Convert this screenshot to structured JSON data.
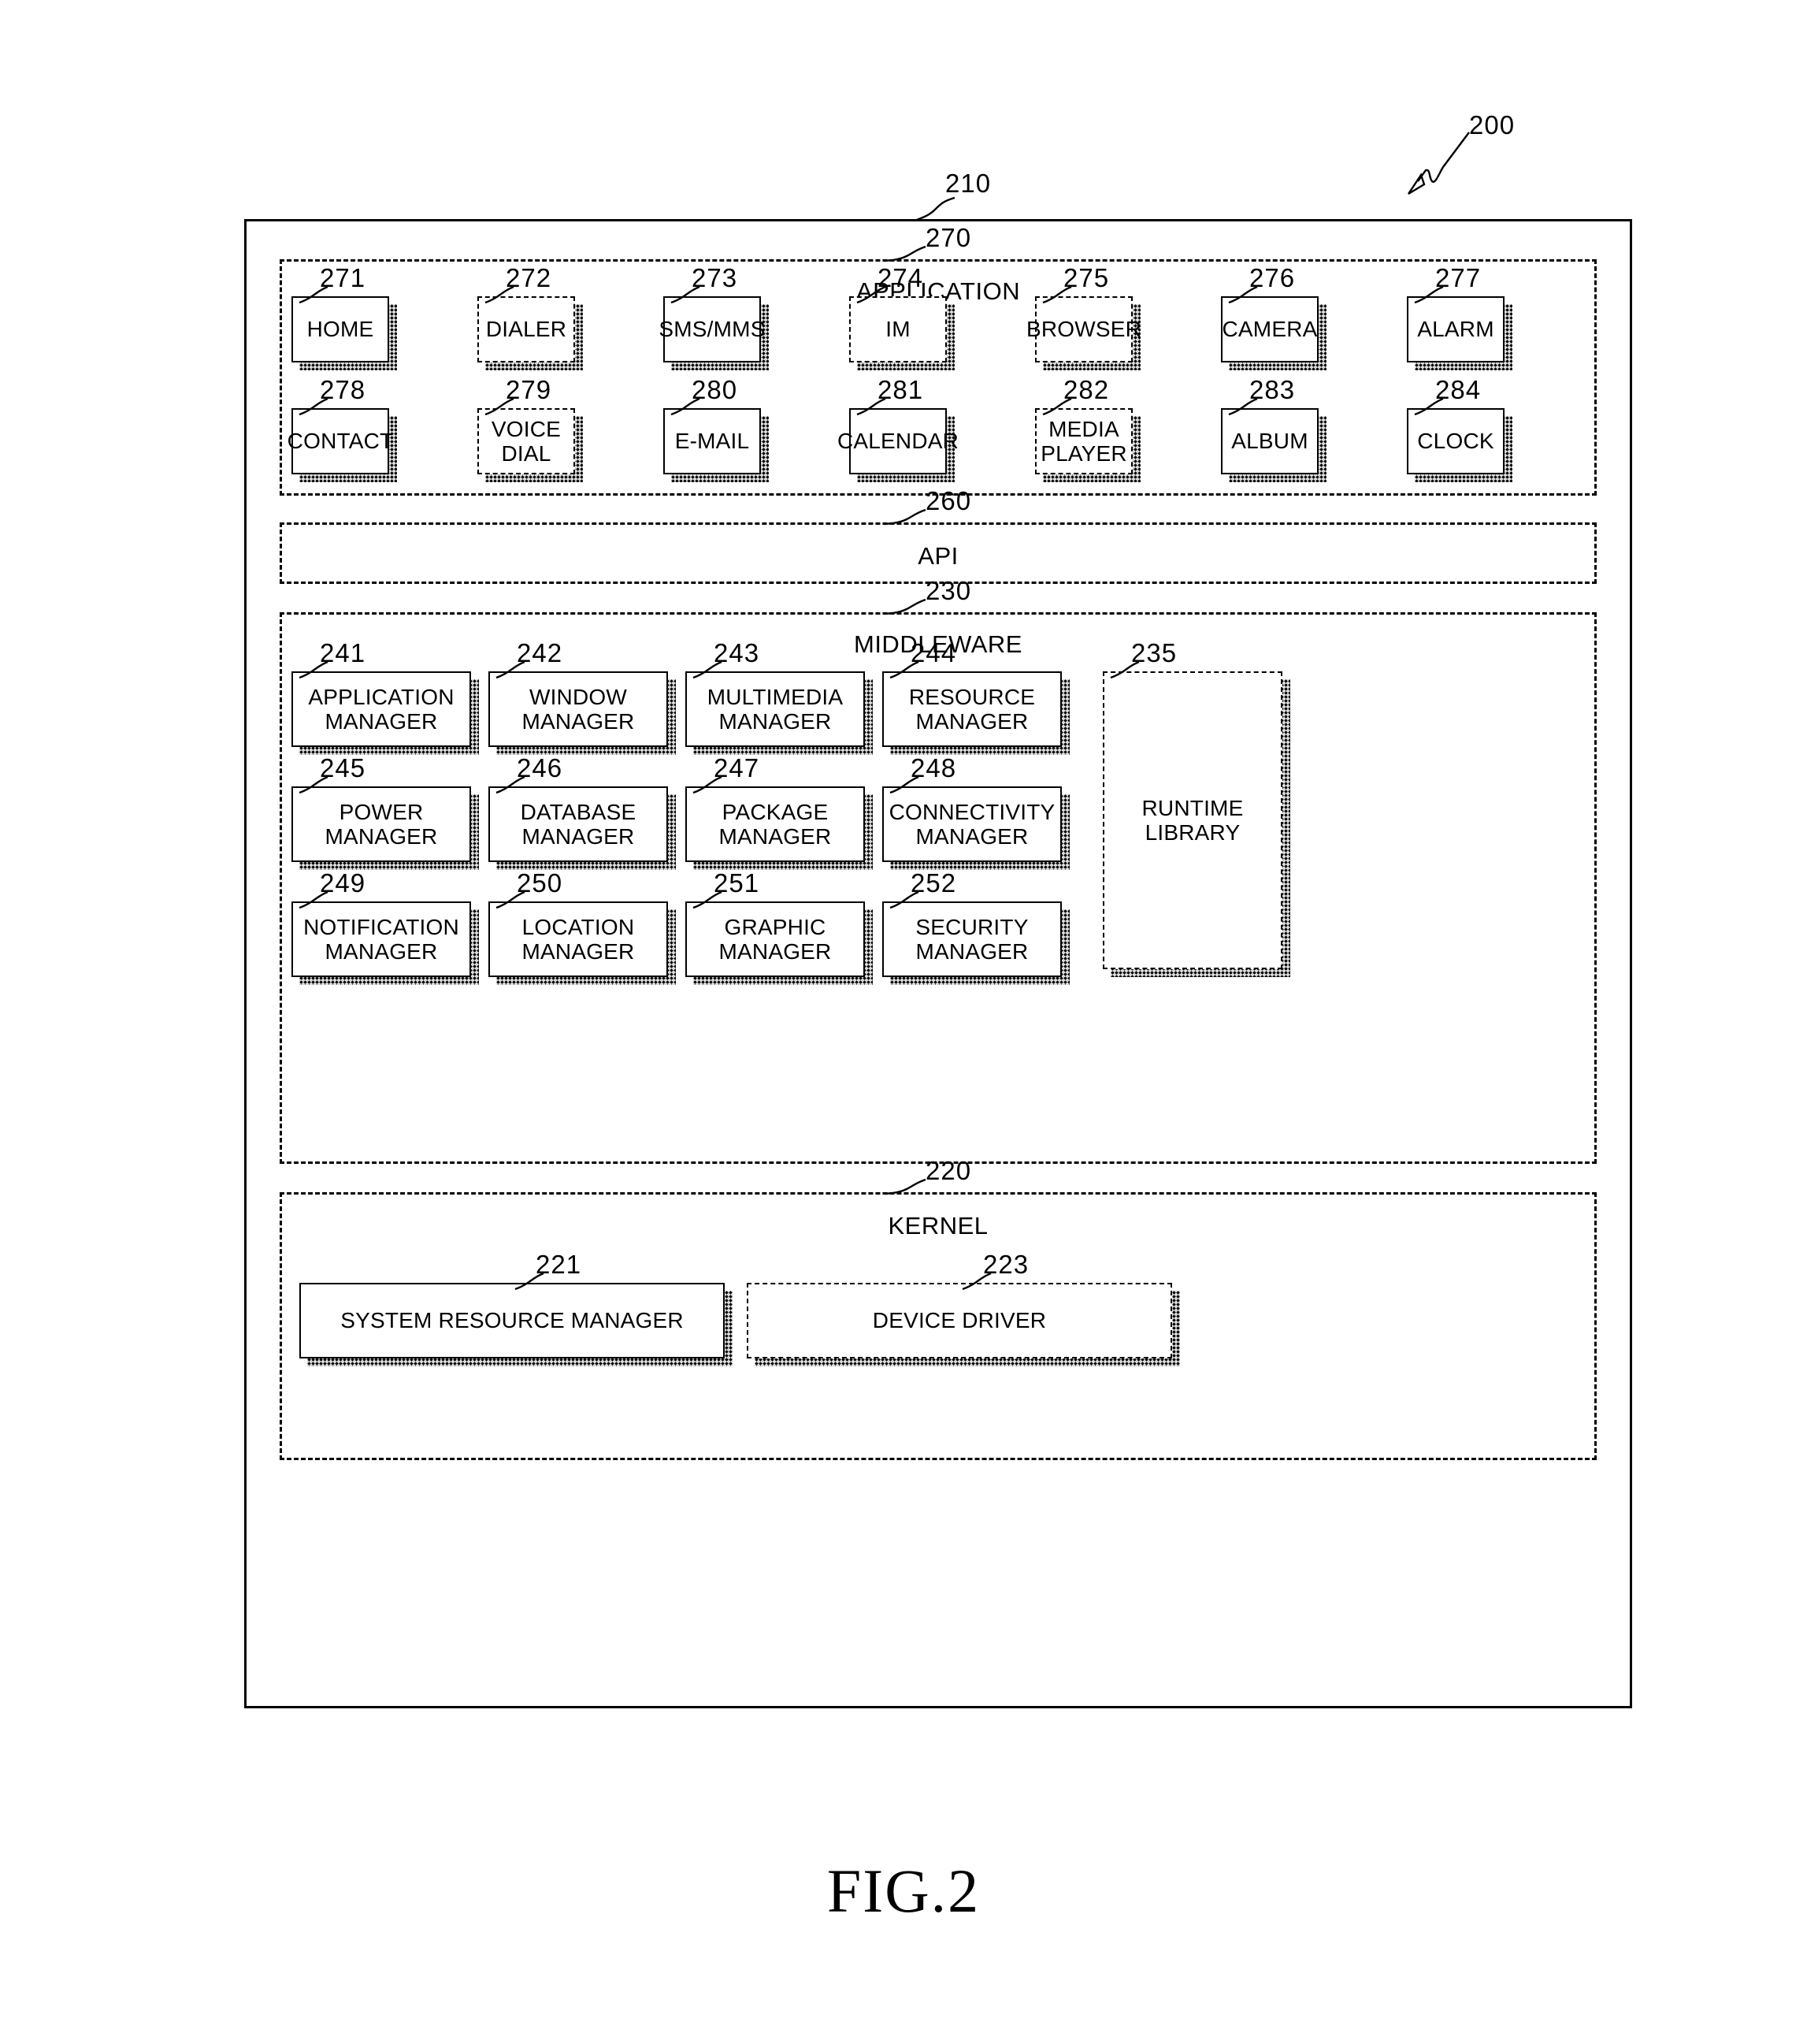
{
  "figure": {
    "caption": "FIG.2",
    "overall_ref": "200",
    "frame_ref": "210"
  },
  "layers": {
    "application": {
      "ref": "270",
      "title": "APPLICATION",
      "modules": [
        {
          "ref": "271",
          "label": "HOME"
        },
        {
          "ref": "272",
          "label": "DIALER"
        },
        {
          "ref": "273",
          "label": "SMS/MMS"
        },
        {
          "ref": "274",
          "label": "IM"
        },
        {
          "ref": "275",
          "label": "BROWSER"
        },
        {
          "ref": "276",
          "label": "CAMERA"
        },
        {
          "ref": "277",
          "label": "ALARM"
        },
        {
          "ref": "278",
          "label": "CONTACT"
        },
        {
          "ref": "279",
          "label": "VOICE DIAL"
        },
        {
          "ref": "280",
          "label": "E-MAIL"
        },
        {
          "ref": "281",
          "label": "CALENDAR"
        },
        {
          "ref": "282",
          "label": "MEDIA\nPLAYER"
        },
        {
          "ref": "283",
          "label": "ALBUM"
        },
        {
          "ref": "284",
          "label": "CLOCK"
        }
      ]
    },
    "api": {
      "ref": "260",
      "title": "API"
    },
    "middleware": {
      "ref": "230",
      "title": "MIDDLEWARE",
      "modules": [
        {
          "ref": "241",
          "label": "APPLICATION\nMANAGER"
        },
        {
          "ref": "242",
          "label": "WINDOW\nMANAGER"
        },
        {
          "ref": "243",
          "label": "MULTIMEDIA\nMANAGER"
        },
        {
          "ref": "244",
          "label": "RESOURCE\nMANAGER"
        },
        {
          "ref": "245",
          "label": "POWER\nMANAGER"
        },
        {
          "ref": "246",
          "label": "DATABASE\nMANAGER"
        },
        {
          "ref": "247",
          "label": "PACKAGE\nMANAGER"
        },
        {
          "ref": "248",
          "label": "CONNECTIVITY\nMANAGER"
        },
        {
          "ref": "249",
          "label": "NOTIFICATION\nMANAGER"
        },
        {
          "ref": "250",
          "label": "LOCATION\nMANAGER"
        },
        {
          "ref": "251",
          "label": "GRAPHIC\nMANAGER"
        },
        {
          "ref": "252",
          "label": "SECURITY\nMANAGER"
        }
      ],
      "runtime_library": {
        "ref": "235",
        "label": "RUNTIME\nLIBRARY"
      }
    },
    "kernel": {
      "ref": "220",
      "title": "KERNEL",
      "modules": [
        {
          "ref": "221",
          "label": "SYSTEM RESOURCE MANAGER"
        },
        {
          "ref": "223",
          "label": "DEVICE DRIVER"
        }
      ]
    }
  }
}
